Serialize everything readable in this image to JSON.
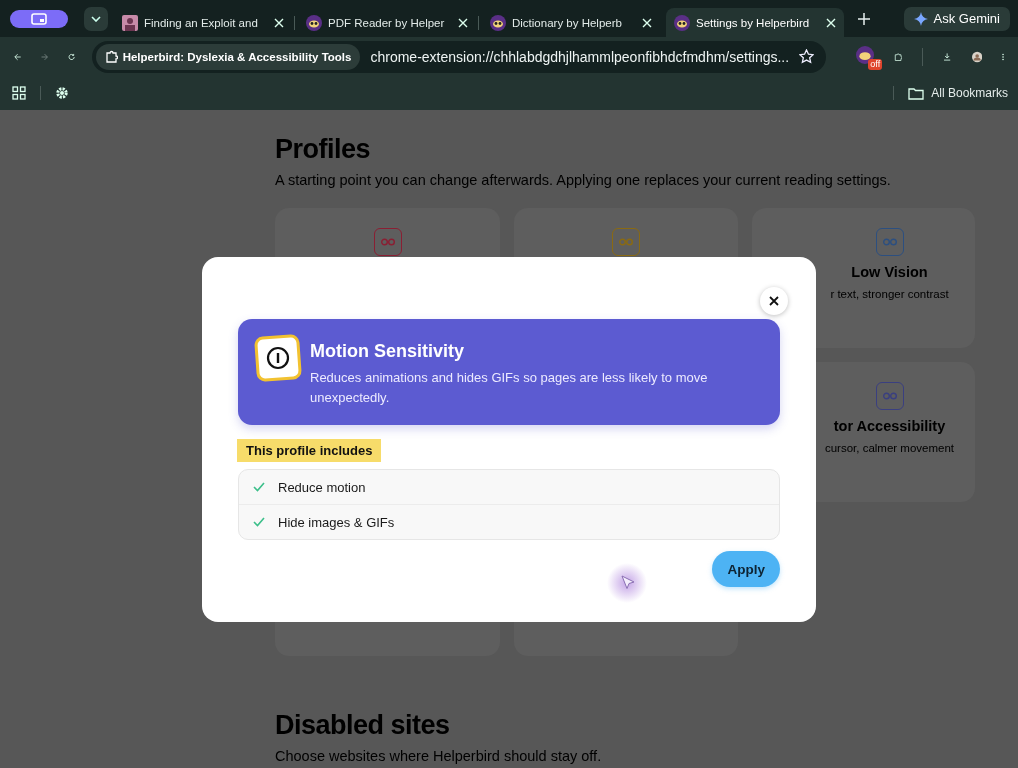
{
  "browser": {
    "tabs": [
      {
        "title": "Finding an Exploit and",
        "selected": false,
        "kind": "photo"
      },
      {
        "title": "PDF Reader by Helper",
        "selected": false,
        "kind": "bird"
      },
      {
        "title": "Dictionary by Helperb",
        "selected": false,
        "kind": "bird"
      },
      {
        "title": "Settings by Helperbird",
        "selected": true,
        "kind": "bird"
      }
    ],
    "gemini": "Ask Gemini",
    "omnibox": {
      "site_chip": "Helperbird: Dyslexia & Accessibility Tools",
      "url": "chrome-extension://chhlabdgdhjlhammlpeonfibhdcfmdhm/settings..."
    },
    "extension_badge": "off",
    "bookmarks": "All Bookmarks"
  },
  "page": {
    "title": "Profiles",
    "subtitle": "A starting point you can change afterwards. Applying one replaces your current reading settings.",
    "cards": [
      {
        "kind": "profile",
        "color": "#8a1f33"
      },
      {
        "kind": "profile",
        "color": "#8a6a12"
      },
      {
        "kind": "profile",
        "title": "Low Vision",
        "description": "r text, stronger contrast",
        "color": "#2c4f80"
      },
      {
        "kind": "profile",
        "title": "tor Accessibility",
        "description": "cursor, calmer movement",
        "color": "#3a3f80"
      },
      {
        "kind": "blank"
      },
      {
        "kind": "blank"
      }
    ],
    "section2_title": "Disabled sites",
    "section2_subtitle": "Choose websites where Helperbird should stay off."
  },
  "modal": {
    "title": "Motion Sensitivity",
    "description": "Reduces animations and hides GIFs so pages are less likely to move unexpectedly.",
    "includes_label": "This profile includes",
    "items": [
      {
        "label": "Reduce motion",
        "checked": true
      },
      {
        "label": "Hide images & GIFs",
        "checked": true
      }
    ],
    "apply": "Apply"
  }
}
